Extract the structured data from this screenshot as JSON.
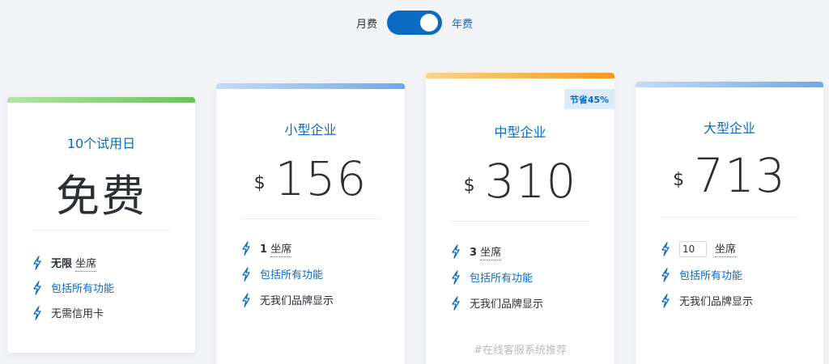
{
  "billing_toggle": {
    "monthly_label": "月费",
    "yearly_label": "年费",
    "selected": "年费"
  },
  "plans": [
    {
      "title": "10个试用日",
      "price_text": "免费",
      "accent": "#7cc96a",
      "features": [
        {
          "strong": "无限",
          "text": "坐席"
        },
        {
          "text": "包括所有功能"
        },
        {
          "text": "无需信用卡"
        }
      ]
    },
    {
      "title": "小型企业",
      "currency": "$",
      "amount": "156",
      "accent": "#8ec2f5",
      "features": [
        {
          "strong": "1",
          "text": "坐席"
        },
        {
          "text": "包括所有功能"
        },
        {
          "text": "无我们品牌显示"
        }
      ]
    },
    {
      "title": "中型企业",
      "currency": "$",
      "amount": "310",
      "accent": "#f5a623",
      "badge": "节省45%",
      "features": [
        {
          "strong": "3",
          "text": "坐席"
        },
        {
          "text": "包括所有功能"
        },
        {
          "text": "无我们品牌显示"
        }
      ],
      "footer": "#在线客服系统推荐"
    },
    {
      "title": "大型企业",
      "currency": "$",
      "amount": "713",
      "accent": "#8ec2f5",
      "seat_input_value": "10",
      "features": [
        {
          "text": "坐席"
        },
        {
          "text": "包括所有功能"
        },
        {
          "text": "无我们品牌显示"
        }
      ]
    }
  ],
  "colors": {
    "primary": "#0b6bc2",
    "background": "#f1f3f6"
  },
  "icons": {
    "feature": "lightning-bolt-icon"
  }
}
